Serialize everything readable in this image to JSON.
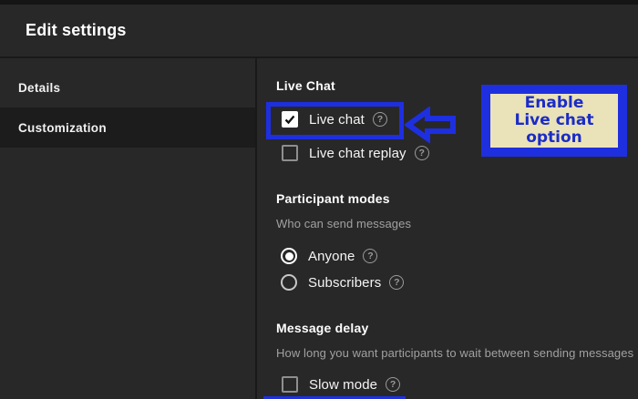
{
  "header": {
    "title": "Edit settings"
  },
  "sidebar": {
    "items": [
      {
        "label": "Details",
        "selected": false
      },
      {
        "label": "Customization",
        "selected": true
      }
    ]
  },
  "main": {
    "sections": [
      {
        "title": "Live Chat",
        "controls": [
          {
            "type": "checkbox",
            "label": "Live chat",
            "checked": true,
            "help_icon": "circled-question-mark"
          },
          {
            "type": "checkbox",
            "label": "Live chat replay",
            "checked": false,
            "help_icon": "circled-question-mark"
          }
        ]
      },
      {
        "title": "Participant modes",
        "description": "Who can send messages",
        "controls": [
          {
            "type": "radio",
            "label": "Anyone",
            "checked": true,
            "help_icon": "circled-question-mark"
          },
          {
            "type": "radio",
            "label": "Subscribers",
            "checked": false,
            "help_icon": "circled-question-mark"
          }
        ]
      },
      {
        "title": "Message delay",
        "description": "How long you want participants to wait between sending messages",
        "controls": [
          {
            "type": "checkbox",
            "label": "Slow mode",
            "checked": false,
            "help_icon": "circled-question-mark"
          }
        ]
      }
    ]
  },
  "annotation": {
    "callout": {
      "lines": [
        "Enable",
        "Live chat",
        "option"
      ]
    },
    "colors": {
      "blue": "#1e2fe0",
      "tan_bg": "#eae2b9",
      "text_blue": "#1b2cc6"
    }
  },
  "icons": {
    "help": "?"
  },
  "theme": {
    "background": "#282828",
    "selected_row": "#1c1c1c",
    "divider": "#191919",
    "text": "#ffffff",
    "muted_text": "#a1a1a1"
  }
}
